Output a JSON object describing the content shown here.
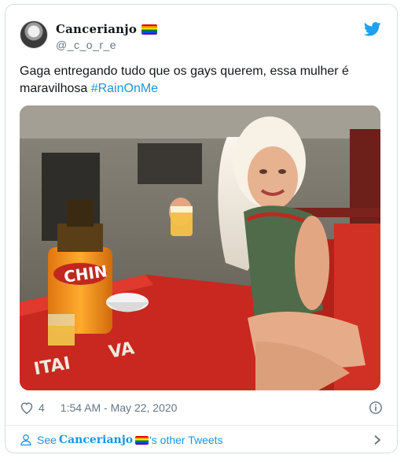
{
  "user": {
    "display_name": "Cancerianjo",
    "handle": "@_c_o_r_e"
  },
  "tweet": {
    "text": "Gaga entregando tudo que os gays querem, essa mulher é maravilhosa ",
    "hashtag": "#RainOnMe"
  },
  "media_labels": {
    "bottle_brand": "CHIN",
    "table_brand": "ITAI",
    "table_brand_tail": "VA"
  },
  "meta": {
    "likes": "4",
    "timestamp": "1:54 AM - May 22, 2020"
  },
  "footer": {
    "prefix": "See",
    "name": "Cancerianjo",
    "suffix": "'s other Tweets"
  },
  "icons": {
    "brand": "twitter-bird-icon",
    "like": "heart-icon",
    "info": "info-icon",
    "profile": "person-icon",
    "next": "chevron-right-icon"
  },
  "colors": {
    "link": "#1b95e0",
    "secondary_text": "#657786",
    "border": "#d5dde2"
  }
}
